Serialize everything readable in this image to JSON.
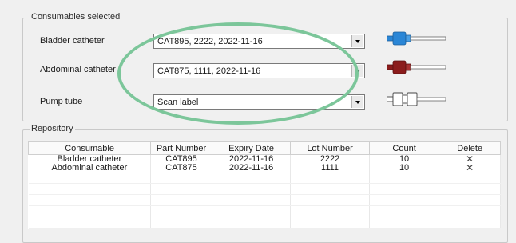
{
  "consumables": {
    "title": "Consumables selected",
    "rows": [
      {
        "label": "Bladder catheter",
        "value": "CAT895, 2222, 2022-11-16",
        "connector_color": "#2a86d6"
      },
      {
        "label": "Abdominal catheter",
        "value": "CAT875, 1111, 2022-11-16",
        "connector_color": "#8b1c1c"
      },
      {
        "label": "Pump tube",
        "value": "Scan label",
        "connector_color": "#ffffff"
      }
    ]
  },
  "repository": {
    "title": "Repository",
    "columns": [
      "Consumable",
      "Part Number",
      "Expiry Date",
      "Lot Number",
      "Count",
      "Delete"
    ],
    "rows": [
      {
        "consumable": "Bladder catheter",
        "part": "CAT895",
        "expiry": "2022-11-16",
        "lot": "2222",
        "count": "10",
        "delete": "✕"
      },
      {
        "consumable": "Abdominal catheter",
        "part": "CAT875",
        "expiry": "2022-11-16",
        "lot": "1111",
        "count": "10",
        "delete": "✕"
      }
    ]
  },
  "annotation": {
    "highlight_color": "#7cc69a"
  }
}
